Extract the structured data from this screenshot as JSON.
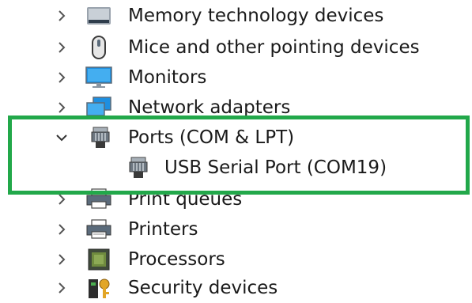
{
  "device_tree": {
    "items": [
      {
        "label": "Memory technology devices",
        "icon": "memory-card-icon",
        "expanded": false
      },
      {
        "label": "Mice and other pointing devices",
        "icon": "mouse-icon",
        "expanded": false
      },
      {
        "label": "Monitors",
        "icon": "monitor-icon",
        "expanded": false
      },
      {
        "label": "Network adapters",
        "icon": "network-adapter-icon",
        "expanded": false
      },
      {
        "label": "Ports (COM & LPT)",
        "icon": "port-icon",
        "expanded": true,
        "children": [
          {
            "label": "USB Serial Port (COM19)",
            "icon": "port-icon"
          }
        ]
      },
      {
        "label": "Print queues",
        "icon": "print-queue-icon",
        "expanded": false
      },
      {
        "label": "Printers",
        "icon": "printer-icon",
        "expanded": false
      },
      {
        "label": "Processors",
        "icon": "processor-icon",
        "expanded": false
      },
      {
        "label": "Security devices",
        "icon": "security-key-icon",
        "expanded": false
      }
    ]
  },
  "colors": {
    "highlight": "#22a84a",
    "monitor_blue": "#1e8fe0",
    "text": "#1a1a1a",
    "chevron": "#555555"
  }
}
